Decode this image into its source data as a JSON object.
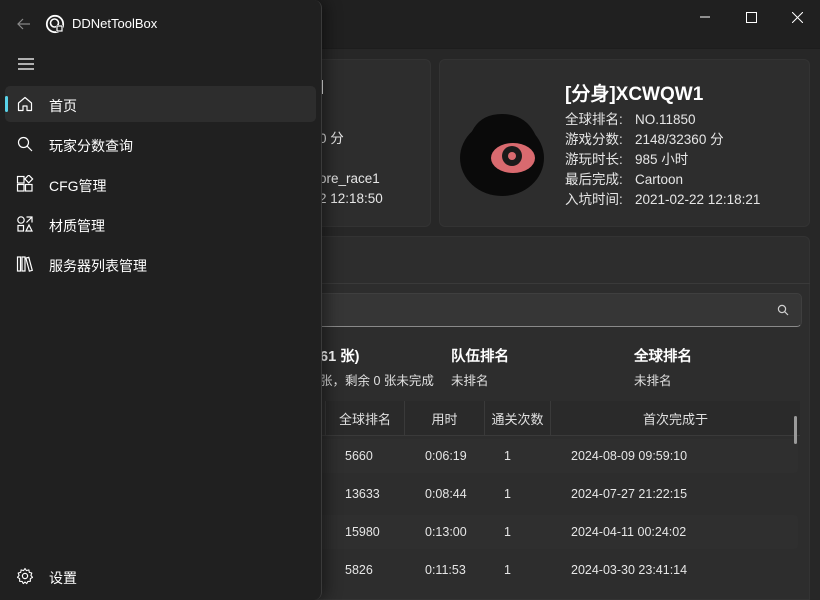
{
  "app": {
    "title": "DDNetToolBox"
  },
  "nav": {
    "items": [
      {
        "label": "首页",
        "icon": "home-icon",
        "active": true
      },
      {
        "label": "玩家分数查询",
        "icon": "search-icon"
      },
      {
        "label": "CFG管理",
        "icon": "grid-icon"
      },
      {
        "label": "材质管理",
        "icon": "shapes-icon"
      },
      {
        "label": "服务器列表管理",
        "icon": "library-icon"
      }
    ],
    "settings_label": "设置"
  },
  "left_card": {
    "name_partial": "l",
    "score_partial": "0 分",
    "last_partial": "ore_race1",
    "join_partial": "2 12:18:50"
  },
  "dummy_card": {
    "name": "[分身]XCWQW1",
    "rows": [
      {
        "key": "全球排名:",
        "value": "NO.11850"
      },
      {
        "key": "游戏分数:",
        "value": "2148/32360 分"
      },
      {
        "key": "游玩时长:",
        "value": "985 小时"
      },
      {
        "key": "最后完成:",
        "value": "Cartoon"
      },
      {
        "key": "入坑时间:",
        "value": "2021-02-22 12:18:21"
      }
    ]
  },
  "stats": {
    "maps_title_partial": "61 张)",
    "maps_sub_partial": "张，剩余 0 张未完成",
    "team_title": "队伍排名",
    "team_value": "未排名",
    "global_title": "全球排名",
    "global_value": "未排名"
  },
  "table": {
    "headers": [
      "全球排名",
      "用时",
      "通关次数",
      "首次完成于"
    ],
    "rows": [
      [
        "5660",
        "0:06:19",
        "1",
        "2024-08-09 09:59:10"
      ],
      [
        "13633",
        "0:08:44",
        "1",
        "2024-07-27 21:22:15"
      ],
      [
        "15980",
        "0:13:00",
        "1",
        "2024-04-11 00:24:02"
      ],
      [
        "5826",
        "0:11:53",
        "1",
        "2024-03-30 23:41:14"
      ]
    ]
  },
  "colors": {
    "accent": "#59d2e8",
    "background": "#202020",
    "card": "#2d2d2d"
  }
}
